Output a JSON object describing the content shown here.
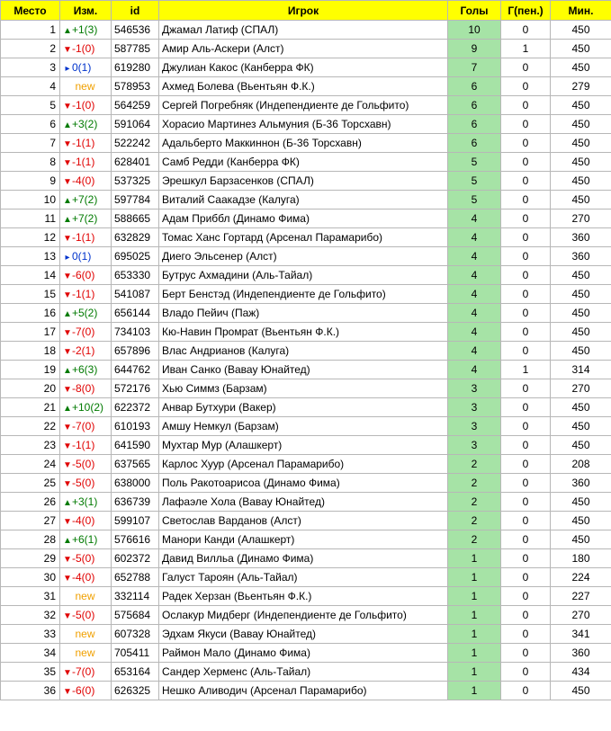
{
  "headers": {
    "place": "Место",
    "change": "Изм.",
    "id": "id",
    "player": "Игрок",
    "goals": "Голы",
    "pen": "Г(пен.)",
    "min": "Мин."
  },
  "rows": [
    {
      "place": "1",
      "dir": "up",
      "chg": "+1(3)",
      "id": "546536",
      "player": "Джамал Латиф (СПАЛ)",
      "goals": "10",
      "pen": "0",
      "min": "450"
    },
    {
      "place": "2",
      "dir": "down",
      "chg": "-1(0)",
      "id": "587785",
      "player": "Амир Аль-Аскери (Алст)",
      "goals": "9",
      "pen": "1",
      "min": "450"
    },
    {
      "place": "3",
      "dir": "same",
      "chg": "0(1)",
      "id": "619280",
      "player": "Джулиан Какос (Канберра ФК)",
      "goals": "7",
      "pen": "0",
      "min": "450"
    },
    {
      "place": "4",
      "dir": "new",
      "chg": "new",
      "id": "578953",
      "player": "Ахмед Болева (Вьентьян Ф.К.)",
      "goals": "6",
      "pen": "0",
      "min": "279"
    },
    {
      "place": "5",
      "dir": "down",
      "chg": "-1(0)",
      "id": "564259",
      "player": "Сергей Погребняк (Индепендиенте де Гольфито)",
      "goals": "6",
      "pen": "0",
      "min": "450"
    },
    {
      "place": "6",
      "dir": "up",
      "chg": "+3(2)",
      "id": "591064",
      "player": "Хорасио Мартинез Альмуния (Б-36 Торсхавн)",
      "goals": "6",
      "pen": "0",
      "min": "450"
    },
    {
      "place": "7",
      "dir": "down",
      "chg": "-1(1)",
      "id": "522242",
      "player": "Адальберто Маккиннон (Б-36 Торсхавн)",
      "goals": "6",
      "pen": "0",
      "min": "450"
    },
    {
      "place": "8",
      "dir": "down",
      "chg": "-1(1)",
      "id": "628401",
      "player": "Самб Редди (Канберра ФК)",
      "goals": "5",
      "pen": "0",
      "min": "450"
    },
    {
      "place": "9",
      "dir": "down",
      "chg": "-4(0)",
      "id": "537325",
      "player": "Эрешкул Барзасенков (СПАЛ)",
      "goals": "5",
      "pen": "0",
      "min": "450"
    },
    {
      "place": "10",
      "dir": "up",
      "chg": "+7(2)",
      "id": "597784",
      "player": "Виталий Саакадзе (Калуга)",
      "goals": "5",
      "pen": "0",
      "min": "450"
    },
    {
      "place": "11",
      "dir": "up",
      "chg": "+7(2)",
      "id": "588665",
      "player": "Адам Приббл (Динамо Фима)",
      "goals": "4",
      "pen": "0",
      "min": "270"
    },
    {
      "place": "12",
      "dir": "down",
      "chg": "-1(1)",
      "id": "632829",
      "player": "Томас Ханс Гортард (Арсенал Парамарибо)",
      "goals": "4",
      "pen": "0",
      "min": "360"
    },
    {
      "place": "13",
      "dir": "same",
      "chg": "0(1)",
      "id": "695025",
      "player": "Диего Эльсенер (Алст)",
      "goals": "4",
      "pen": "0",
      "min": "360"
    },
    {
      "place": "14",
      "dir": "down",
      "chg": "-6(0)",
      "id": "653330",
      "player": "Бутрус Ахмадини (Аль-Тайал)",
      "goals": "4",
      "pen": "0",
      "min": "450"
    },
    {
      "place": "15",
      "dir": "down",
      "chg": "-1(1)",
      "id": "541087",
      "player": "Берт Бенстэд (Индепендиенте де Гольфито)",
      "goals": "4",
      "pen": "0",
      "min": "450"
    },
    {
      "place": "16",
      "dir": "up",
      "chg": "+5(2)",
      "id": "656144",
      "player": "Владо Пейич (Паж)",
      "goals": "4",
      "pen": "0",
      "min": "450"
    },
    {
      "place": "17",
      "dir": "down",
      "chg": "-7(0)",
      "id": "734103",
      "player": "Кю-Навин Промрат (Вьентьян Ф.К.)",
      "goals": "4",
      "pen": "0",
      "min": "450"
    },
    {
      "place": "18",
      "dir": "down",
      "chg": "-2(1)",
      "id": "657896",
      "player": "Влас Андрианов (Калуга)",
      "goals": "4",
      "pen": "0",
      "min": "450"
    },
    {
      "place": "19",
      "dir": "up",
      "chg": "+6(3)",
      "id": "644762",
      "player": "Иван Санко (Вавау Юнайтед)",
      "goals": "4",
      "pen": "1",
      "min": "314"
    },
    {
      "place": "20",
      "dir": "down",
      "chg": "-8(0)",
      "id": "572176",
      "player": "Хью Симмз (Барзам)",
      "goals": "3",
      "pen": "0",
      "min": "270"
    },
    {
      "place": "21",
      "dir": "up",
      "chg": "+10(2)",
      "id": "622372",
      "player": "Анвар Бутхури (Вакер)",
      "goals": "3",
      "pen": "0",
      "min": "450"
    },
    {
      "place": "22",
      "dir": "down",
      "chg": "-7(0)",
      "id": "610193",
      "player": "Амшу Немкул (Барзам)",
      "goals": "3",
      "pen": "0",
      "min": "450"
    },
    {
      "place": "23",
      "dir": "down",
      "chg": "-1(1)",
      "id": "641590",
      "player": "Мухтар Мур (Алашкерт)",
      "goals": "3",
      "pen": "0",
      "min": "450"
    },
    {
      "place": "24",
      "dir": "down",
      "chg": "-5(0)",
      "id": "637565",
      "player": "Карлос Хуур (Арсенал Парамарибо)",
      "goals": "2",
      "pen": "0",
      "min": "208"
    },
    {
      "place": "25",
      "dir": "down",
      "chg": "-5(0)",
      "id": "638000",
      "player": "Поль Ракотоарисоа (Динамо Фима)",
      "goals": "2",
      "pen": "0",
      "min": "360"
    },
    {
      "place": "26",
      "dir": "up",
      "chg": "+3(1)",
      "id": "636739",
      "player": "Лафаэле Хола (Вавау Юнайтед)",
      "goals": "2",
      "pen": "0",
      "min": "450"
    },
    {
      "place": "27",
      "dir": "down",
      "chg": "-4(0)",
      "id": "599107",
      "player": "Светослав Варданов (Алст)",
      "goals": "2",
      "pen": "0",
      "min": "450"
    },
    {
      "place": "28",
      "dir": "up",
      "chg": "+6(1)",
      "id": "576616",
      "player": "Манори Канди (Алашкерт)",
      "goals": "2",
      "pen": "0",
      "min": "450"
    },
    {
      "place": "29",
      "dir": "down",
      "chg": "-5(0)",
      "id": "602372",
      "player": "Давид Вилльа (Динамо Фима)",
      "goals": "1",
      "pen": "0",
      "min": "180"
    },
    {
      "place": "30",
      "dir": "down",
      "chg": "-4(0)",
      "id": "652788",
      "player": "Галуст Тароян (Аль-Тайал)",
      "goals": "1",
      "pen": "0",
      "min": "224"
    },
    {
      "place": "31",
      "dir": "new",
      "chg": "new",
      "id": "332114",
      "player": "Радек Херзан (Вьентьян Ф.К.)",
      "goals": "1",
      "pen": "0",
      "min": "227"
    },
    {
      "place": "32",
      "dir": "down",
      "chg": "-5(0)",
      "id": "575684",
      "player": "Ослакур Мидберг (Индепендиенте де Гольфито)",
      "goals": "1",
      "pen": "0",
      "min": "270"
    },
    {
      "place": "33",
      "dir": "new",
      "chg": "new",
      "id": "607328",
      "player": "Эдхам Якуси (Вавау Юнайтед)",
      "goals": "1",
      "pen": "0",
      "min": "341"
    },
    {
      "place": "34",
      "dir": "new",
      "chg": "new",
      "id": "705411",
      "player": "Раймон Мало (Динамо Фима)",
      "goals": "1",
      "pen": "0",
      "min": "360"
    },
    {
      "place": "35",
      "dir": "down",
      "chg": "-7(0)",
      "id": "653164",
      "player": "Сандер Херменс (Аль-Тайал)",
      "goals": "1",
      "pen": "0",
      "min": "434"
    },
    {
      "place": "36",
      "dir": "down",
      "chg": "-6(0)",
      "id": "626325",
      "player": "Нешко Аливодич (Арсенал Парамарибо)",
      "goals": "1",
      "pen": "0",
      "min": "450"
    }
  ]
}
